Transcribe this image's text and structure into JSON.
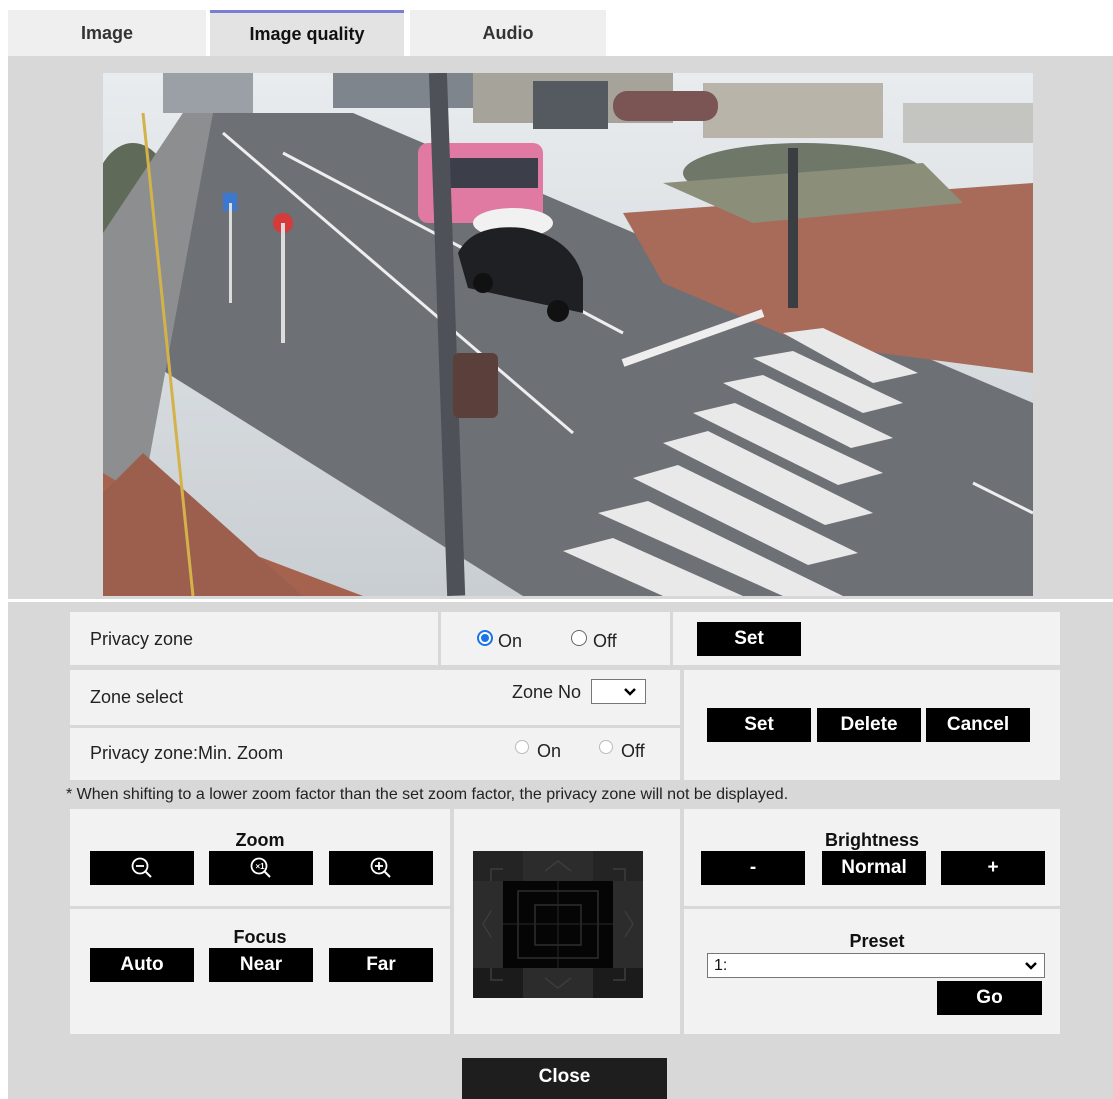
{
  "tabs": [
    {
      "label": "Image",
      "active": false
    },
    {
      "label": "Image quality",
      "active": true
    },
    {
      "label": "Audio",
      "active": false
    }
  ],
  "privacy_zone": {
    "label": "Privacy zone",
    "on_label": "On",
    "off_label": "Off",
    "selected": "On",
    "set_label": "Set"
  },
  "zone_select": {
    "label": "Zone select",
    "zone_no_label": "Zone No",
    "zone_no_value": ""
  },
  "min_zoom": {
    "label": "Privacy zone:Min. Zoom",
    "on_label": "On",
    "off_label": "Off"
  },
  "zone_buttons": {
    "set_label": "Set",
    "delete_label": "Delete",
    "cancel_label": "Cancel"
  },
  "note": "* When shifting to a lower zoom factor than the set zoom factor, the privacy zone will not be displayed.",
  "zoom": {
    "title": "Zoom",
    "buttons": [
      "zoom-out-icon",
      "zoom-reset-icon",
      "zoom-in-icon"
    ]
  },
  "focus": {
    "title": "Focus",
    "auto_label": "Auto",
    "near_label": "Near",
    "far_label": "Far"
  },
  "brightness": {
    "title": "Brightness",
    "minus_label": "-",
    "normal_label": "Normal",
    "plus_label": "+"
  },
  "preset": {
    "title": "Preset",
    "selected": "1:",
    "go_label": "Go"
  },
  "close_label": "Close",
  "colors": {
    "accent_tab": "#7b7ed0",
    "button_bg": "#000000",
    "panel_bg": "#f2f2f2",
    "main_bg": "#d8d8d8",
    "radio_selected": "#1a73e8"
  }
}
